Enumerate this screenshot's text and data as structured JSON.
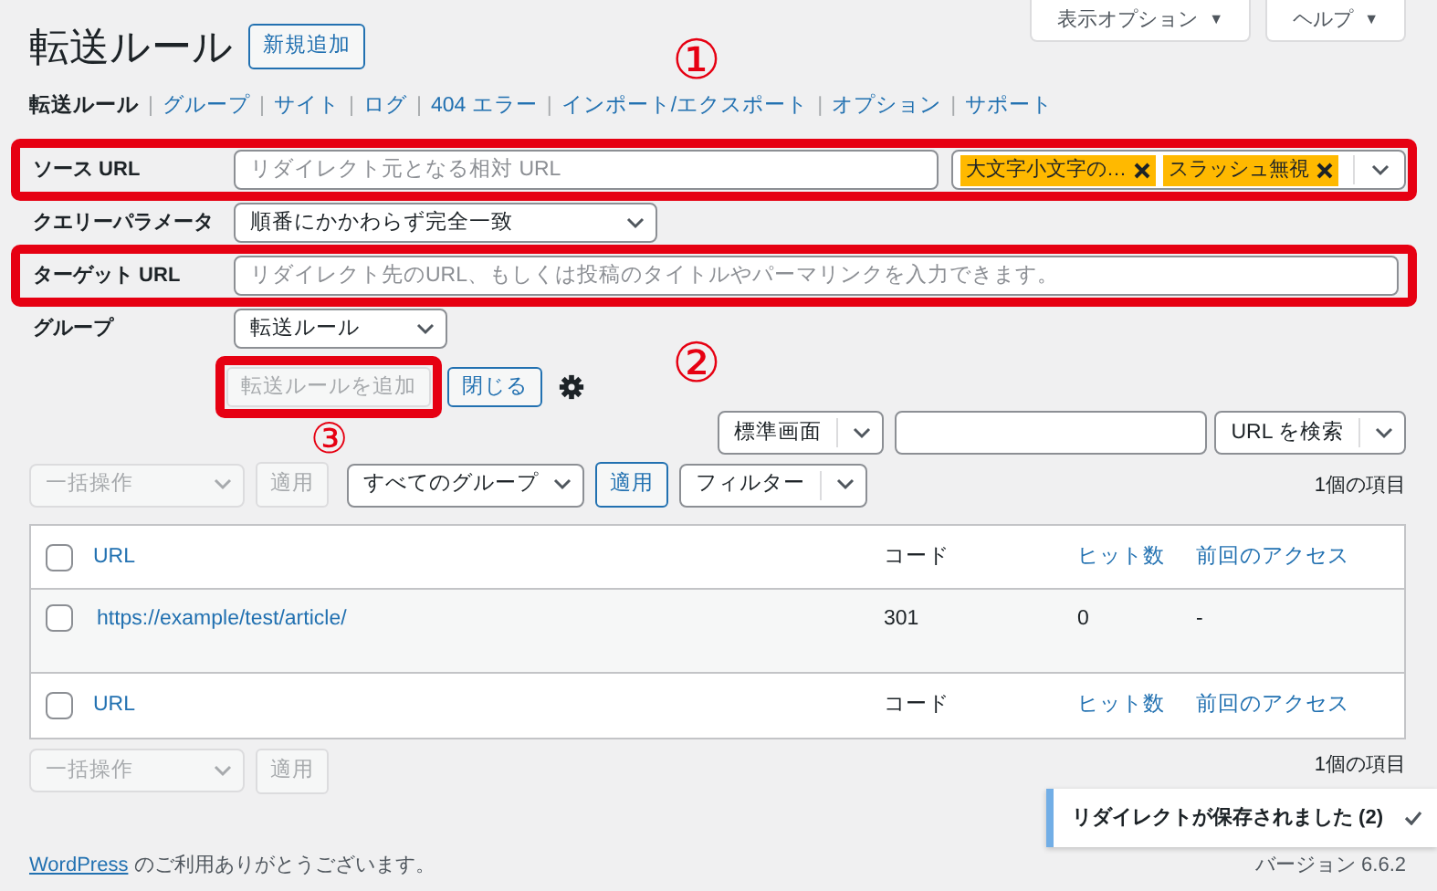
{
  "screen_meta": [
    {
      "label": "表示オプション",
      "caret": "▼"
    },
    {
      "label": "ヘルプ",
      "caret": "▼"
    }
  ],
  "page_title": "転送ルール",
  "add_new": "新規追加",
  "subnav": [
    {
      "label": "転送ルール",
      "selected": true
    },
    {
      "label": "グループ",
      "selected": false,
      "separator": "|"
    },
    {
      "label": "サイト",
      "selected": false,
      "separator": "|"
    },
    {
      "label": "ログ",
      "selected": false,
      "separator": "|"
    },
    {
      "label": "404 エラー",
      "selected": false,
      "separator": "|"
    },
    {
      "label": "インポート/エクスポート",
      "selected": false,
      "separator": "|"
    },
    {
      "label": "オプション",
      "selected": false,
      "separator": "|"
    },
    {
      "label": "サポート",
      "selected": false,
      "separator": "|"
    }
  ],
  "form": [
    {
      "kind": "input",
      "label": "ソース URL",
      "placeholder": "リダイレクト元となる相対 URL",
      "highlighted": true,
      "tags": [
        {
          "label": "大文字小文字の…"
        },
        {
          "label": "スラッシュ無視"
        }
      ]
    },
    {
      "kind": "select",
      "label": "クエリーパラメータ",
      "value": "順番にかかわらず完全一致",
      "highlighted": false
    },
    {
      "kind": "input",
      "label": "ターゲット URL",
      "placeholder": "リダイレクト先のURL、もしくは投稿のタイトルやパーマリンクを入力できます。",
      "highlighted": true
    },
    {
      "kind": "select",
      "label": "グループ",
      "value": "転送ルール",
      "highlighted": false
    }
  ],
  "form_actions": {
    "add": {
      "label": "転送ルールを追加",
      "disabled": true,
      "highlighted": true
    },
    "close": "閉じる"
  },
  "search": {
    "view": "標準画面",
    "button": "URL を検索"
  },
  "bulk_top": {
    "action": "一括操作",
    "disabled": true,
    "apply": "適用",
    "group": "すべてのグループ",
    "apply_group": "適用",
    "filter": "フィルター",
    "count": "1個の項目"
  },
  "table": {
    "columns": [
      {
        "label": "URL",
        "link": true
      },
      {
        "label": "コード",
        "link": false
      },
      {
        "label": "ヒット数",
        "link": true
      },
      {
        "label": "前回のアクセス",
        "link": true
      }
    ],
    "header_checked": false,
    "rows": [
      {
        "checked": false,
        "url": "https://example/test/article/",
        "code": "301",
        "hits": "0",
        "last": "-"
      }
    ],
    "footer_columns": [
      {
        "label": "URL",
        "link": true
      },
      {
        "label": "コード",
        "link": false
      },
      {
        "label": "ヒット数",
        "link": true
      },
      {
        "label": "前回のアクセス",
        "link": true
      }
    ],
    "footer_checked": false
  },
  "bulk_bottom": {
    "action": "一括操作",
    "disabled": true,
    "apply": "適用",
    "count": "1個の項目"
  },
  "toast": "リダイレクトが保存されました (2)",
  "footer": {
    "link": "WordPress",
    "text": "のご利用ありがとうございます。",
    "version": "バージョン 6.6.2"
  },
  "markers": [
    {
      "label": "①"
    },
    {
      "label": "②"
    },
    {
      "label": "③"
    }
  ]
}
